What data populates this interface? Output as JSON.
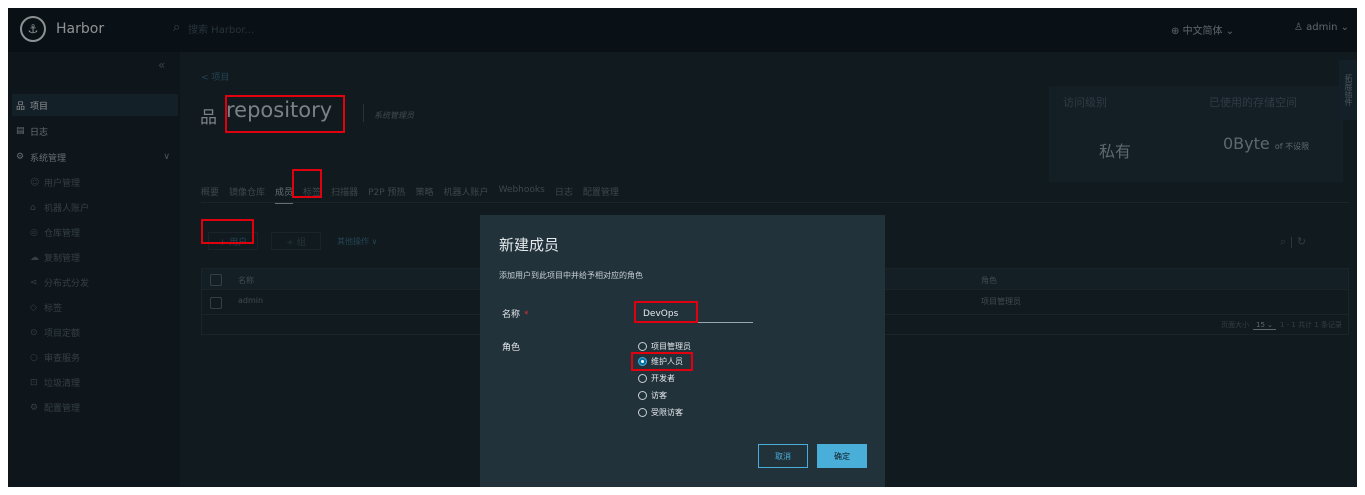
{
  "topbar": {
    "brand": "Harbor",
    "search_placeholder": "搜索 Harbor...",
    "language": "中文简体 ⌄",
    "user": "admin ⌄"
  },
  "sidebar": {
    "collapse": "«",
    "projects": "项目",
    "logs": "日志",
    "admin": "系统管理",
    "admin_items": [
      "用户管理",
      "机器人账户",
      "仓库管理",
      "复制管理",
      "分布式分发",
      "标签",
      "项目定额",
      "审查服务",
      "垃圾清理",
      "配置管理"
    ]
  },
  "main": {
    "back": "< 项目",
    "project_title": "repository",
    "project_role": "系统管理员",
    "access_card": {
      "label": "访问级别",
      "value": "私有"
    },
    "storage_card": {
      "label": "已使用的存储空间",
      "value": "0Byte",
      "suffix": "of 不设限"
    },
    "side_tab": "拓展插件",
    "tabs": [
      "概要",
      "镜像仓库",
      "成员",
      "标签",
      "扫描器",
      "P2P 预热",
      "策略",
      "机器人账户",
      "Webhooks",
      "日志",
      "配置管理"
    ],
    "active_tab": "成员",
    "actions": {
      "add_user": "+ 用户",
      "add_group": "+ 组",
      "more": "其他操作 ∨",
      "tools": "⌕ | ↻"
    },
    "table": {
      "col_name": "名称",
      "col_role": "角色",
      "rows": [
        {
          "name": "admin",
          "role": "项目管理员"
        }
      ],
      "pager_prefix": "页面大小",
      "pager_size": "15 ⌄",
      "pager_info": "1 - 1 共计 1 条记录"
    }
  },
  "modal": {
    "title": "新建成员",
    "description": "添加用户到此项目中并给予相对应的角色",
    "name_label": "名称",
    "required_mark": "*",
    "name_value": "DevOps",
    "role_label": "角色",
    "roles": [
      {
        "label": "项目管理员",
        "selected": false
      },
      {
        "label": "维护人员",
        "selected": true
      },
      {
        "label": "开发者",
        "selected": false
      },
      {
        "label": "访客",
        "selected": false
      },
      {
        "label": "受限访客",
        "selected": false
      }
    ],
    "cancel": "取消",
    "confirm": "确定"
  },
  "colors": {
    "background": "#1b2a32",
    "topbar": "#0f1c24",
    "accent": "#49afd9",
    "highlight": "#e0000e"
  }
}
